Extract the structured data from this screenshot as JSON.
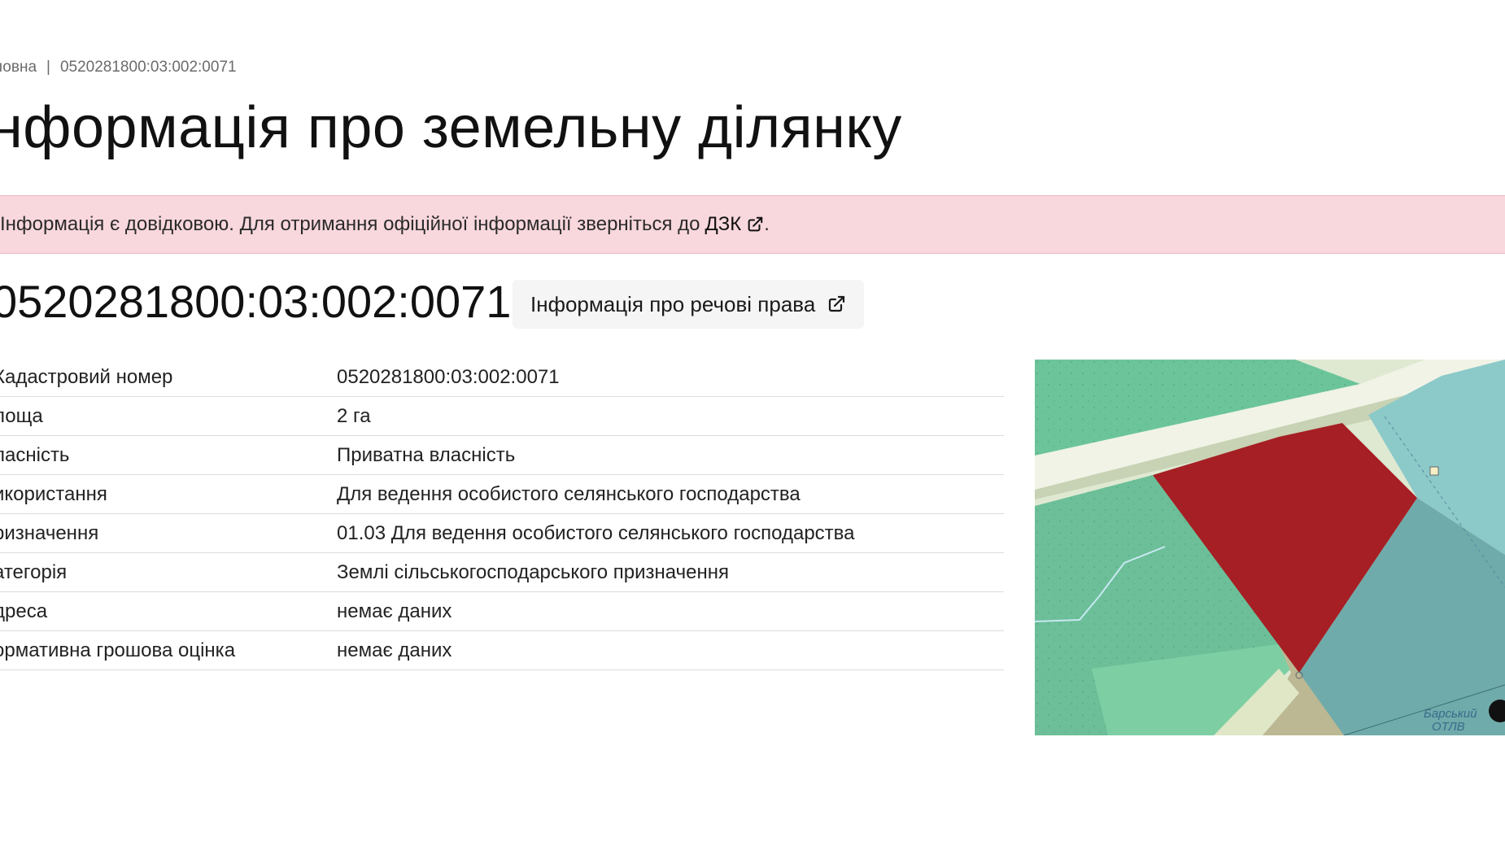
{
  "breadcrumb": {
    "home": "ловна",
    "separator": "|",
    "current": "0520281800:03:002:0071"
  },
  "page_title": "нформація про земельну ділянку",
  "alert": {
    "text": "Інформація є довідковою. Для отримання офіційної інформації зверніться до",
    "link_label": "ДЗК",
    "trailing": ".",
    "background": "#f8d7dd"
  },
  "cadastral_heading": "0520281800:03:002:0071",
  "rights_button": {
    "label": "Інформація про речові права"
  },
  "table": {
    "rows": [
      {
        "label": "Кадастровий номер",
        "value": "0520281800:03:002:0071"
      },
      {
        "label": "лоща",
        "value": "2 га"
      },
      {
        "label": "ласність",
        "value": "Приватна власність"
      },
      {
        "label": "икористання",
        "value": "Для ведення особистого селянського господарства"
      },
      {
        "label": "ризначення",
        "value": "01.03 Для ведення особистого селянського господарства"
      },
      {
        "label": "атегорія",
        "value": "Землі сільськогосподарського призначення"
      },
      {
        "label": "дреса",
        "value": "немає даних"
      },
      {
        "label": "ормативна грошова оцінка",
        "value": "немає даних"
      }
    ]
  },
  "map": {
    "label": "Барський\nОТЛВ",
    "parcel_color": "#a51f24",
    "colors": {
      "forest": "#6cc59a",
      "road": "#f0f3e6",
      "teal": "#70abab",
      "light_teal": "#8cc9c9",
      "tan": "#bcb893"
    }
  }
}
